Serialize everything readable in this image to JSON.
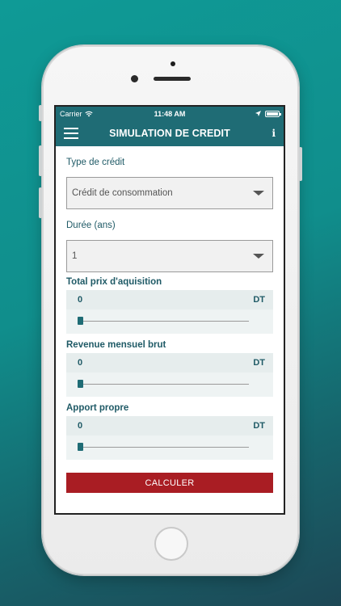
{
  "status_bar": {
    "carrier": "Carrier",
    "time": "11:48 AM"
  },
  "header": {
    "title": "SIMULATION DE CREDIT",
    "info": "i"
  },
  "credit_type": {
    "label": "Type de crédit",
    "value": "Crédit de consommation"
  },
  "duration": {
    "label": "Durée (ans)",
    "value": "1"
  },
  "fields": [
    {
      "label": "Total prix d'aquisition",
      "value": "0",
      "unit": "DT",
      "slider_fraction": 0
    },
    {
      "label": "Revenue mensuel brut",
      "value": "0",
      "unit": "DT",
      "slider_fraction": 0
    },
    {
      "label": "Apport propre",
      "value": "0",
      "unit": "DT",
      "slider_fraction": 0
    }
  ],
  "submit": {
    "label": "CALCULER"
  },
  "colors": {
    "accent": "#1f6c75",
    "button": "#a91d23",
    "background": "#108e8c"
  }
}
